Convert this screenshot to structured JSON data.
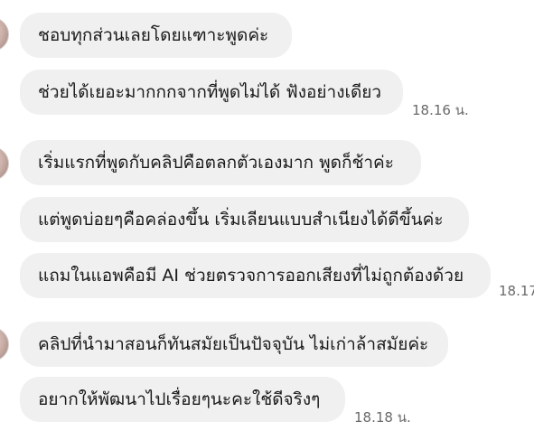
{
  "messages": [
    {
      "text": "ชอบทุกส่วนเลยโดยแฑาะพูดค่ะ"
    },
    {
      "text": "ช่วยได้เยอะมากกกจากที่พูดไม่ได้ ฟังอย่างเดียว",
      "time": "18.16 น."
    },
    {
      "text": "เริ่มแรกที่พูดกับคลิปคือตลกตัวเองมาก พูดก็ช้าค่ะ"
    },
    {
      "text": "แต่พูดบ่อยๆคือคล่องขึ้น เริ่มเลียนแบบสำเนียงได้ดีขึ้นค่ะ"
    },
    {
      "text": "แถมในแอพคือมี AI ช่วยตรวจการออกเสียงที่ไม่ถูกต้องด้วย",
      "time": "18.17"
    },
    {
      "text": "คลิปที่นำมาสอนก็ทันสมัยเป็นปัจจุบัน ไม่เก่าล้าสมัยค่ะ"
    },
    {
      "text": "อยากให้พัฒนาไปเรื่อยๆนะคะใช้ดีจริงๆ",
      "time": "18.18 น."
    }
  ],
  "colors": {
    "bubble": "#f0f0f0",
    "text": "#1a1a1a",
    "timestamp": "#6a6a6a",
    "background": "#ffffff"
  }
}
